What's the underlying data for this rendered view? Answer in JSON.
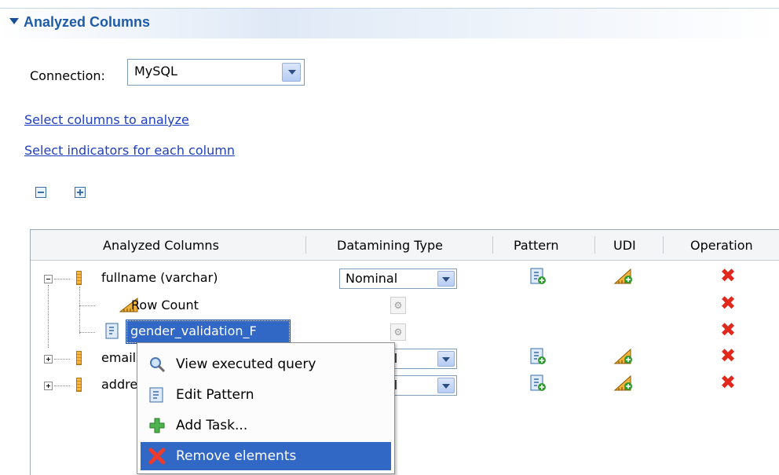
{
  "section": {
    "title": "Analyzed Columns"
  },
  "connection": {
    "label": "Connection:",
    "value": "MySQL"
  },
  "links": {
    "select_columns": "Select columns to analyze",
    "select_indicators": "Select indicators for each column"
  },
  "table": {
    "headers": [
      "Analyzed Columns",
      "Datamining Type",
      "Pattern",
      "UDI",
      "Operation"
    ],
    "rows": [
      {
        "name": "fullname (varchar)",
        "datamining_type": "Nominal"
      },
      {
        "name": "Row Count"
      },
      {
        "name": "gender_validation_F"
      },
      {
        "name": "email",
        "datamining_type": "Nominal"
      },
      {
        "name": "address",
        "datamining_type": "Nominal"
      }
    ]
  },
  "context_menu": {
    "items": [
      {
        "label": "View executed query",
        "icon": "magnifier-icon"
      },
      {
        "label": "Edit Pattern",
        "icon": "pattern-icon"
      },
      {
        "label": "Add Task...",
        "icon": "green-plus-icon"
      },
      {
        "label": "Remove elements",
        "icon": "red-x-icon"
      }
    ]
  },
  "colors": {
    "section_title": "#1f5ca8",
    "link": "#1f3fbf",
    "selection": "#3168c6",
    "remove": "#e0281c"
  }
}
